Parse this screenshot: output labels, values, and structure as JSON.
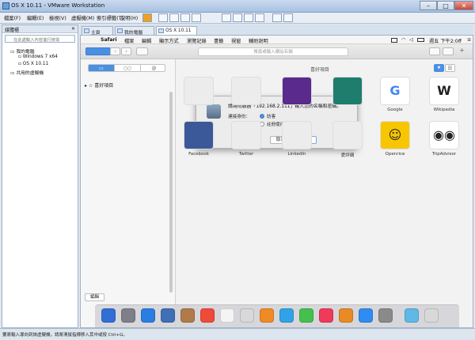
{
  "window": {
    "title": "OS X 10.11 - VMware Workstation",
    "min": "–",
    "max": "□",
    "close": "✕"
  },
  "menu": [
    "檔案(F)",
    "編輯(E)",
    "檢視(V)",
    "虛擬機(M)",
    "索引標籤(T)",
    "說明(H)"
  ],
  "library": {
    "title": "媒體櫃",
    "close": "✕",
    "search_placeholder": "在此處輸入內容進行搜尋",
    "tree": [
      "我的電腦",
      "Windows 7 x64",
      "OS X 10.11",
      "共用的虛擬機"
    ]
  },
  "tabs": [
    "主頁",
    "我的電腦",
    "OS X 10.11"
  ],
  "mac_menu": {
    "apple": "",
    "items": [
      "Safari",
      "檔案",
      "編輯",
      "顯示方式",
      "瀏覽記錄",
      "書籤",
      "視窗",
      "輔助說明"
    ],
    "clock": "週五 下午2:00"
  },
  "address_placeholder": "搜尋或輸入網站名稱",
  "sidebar": {
    "seg": [
      "▭",
      "○○",
      "@"
    ],
    "favorites": "喜好項目",
    "edit": "編輯"
  },
  "content": {
    "title": "喜好項目",
    "view_star": "★",
    "view_list": "☷",
    "tiles": [
      {
        "label": "",
        "color": "#ececec",
        "icon": ""
      },
      {
        "label": "",
        "color": "#ececec",
        "icon": ""
      },
      {
        "label": "",
        "color": "#5a2a8c",
        "icon": ""
      },
      {
        "label": "",
        "color": "#1f7d6e",
        "icon": ""
      },
      {
        "label": "Google",
        "color": "#ffffff",
        "icon": "G"
      },
      {
        "label": "Wikipedia",
        "color": "#ffffff",
        "icon": "W"
      },
      {
        "label": "Facebook",
        "color": "#3b5998",
        "icon": ""
      },
      {
        "label": "Twitter",
        "color": "#ececec",
        "icon": ""
      },
      {
        "label": "LinkedIn",
        "color": "#ececec",
        "icon": ""
      },
      {
        "label": "愛評網",
        "color": "#ececec",
        "icon": ""
      },
      {
        "label": "Openrice",
        "color": "#f7c600",
        "icon": "☺"
      },
      {
        "label": "TripAdvisor",
        "color": "#ffffff",
        "icon": "◉◉"
      }
    ]
  },
  "dialog": {
    "message": "請為伺服器「192.168.2.111」輸入您的名稱和密碼。",
    "connect_as": "連接身份：",
    "guest": "訪客",
    "registered": "註冊使用者",
    "cancel": "取消",
    "connect": "連線"
  },
  "dock_icons": [
    "#2f6fd6",
    "#7f7f8a",
    "#2a7de1",
    "#3f6fb5",
    "#b07a4a",
    "#f04a3a",
    "#f4f4f4",
    "#d8d8d8",
    "#f08a24",
    "#2fa3e6",
    "#45c04e",
    "#f03a5a",
    "#e88a25",
    "#2f8cf0",
    "#8a8a8a",
    "#5fb8e6",
    "#d8d8d8"
  ],
  "statusbar": "要將輸入導向到該虛擬機，請將滑鼠指標移入其中或按 Ctrl+G。"
}
